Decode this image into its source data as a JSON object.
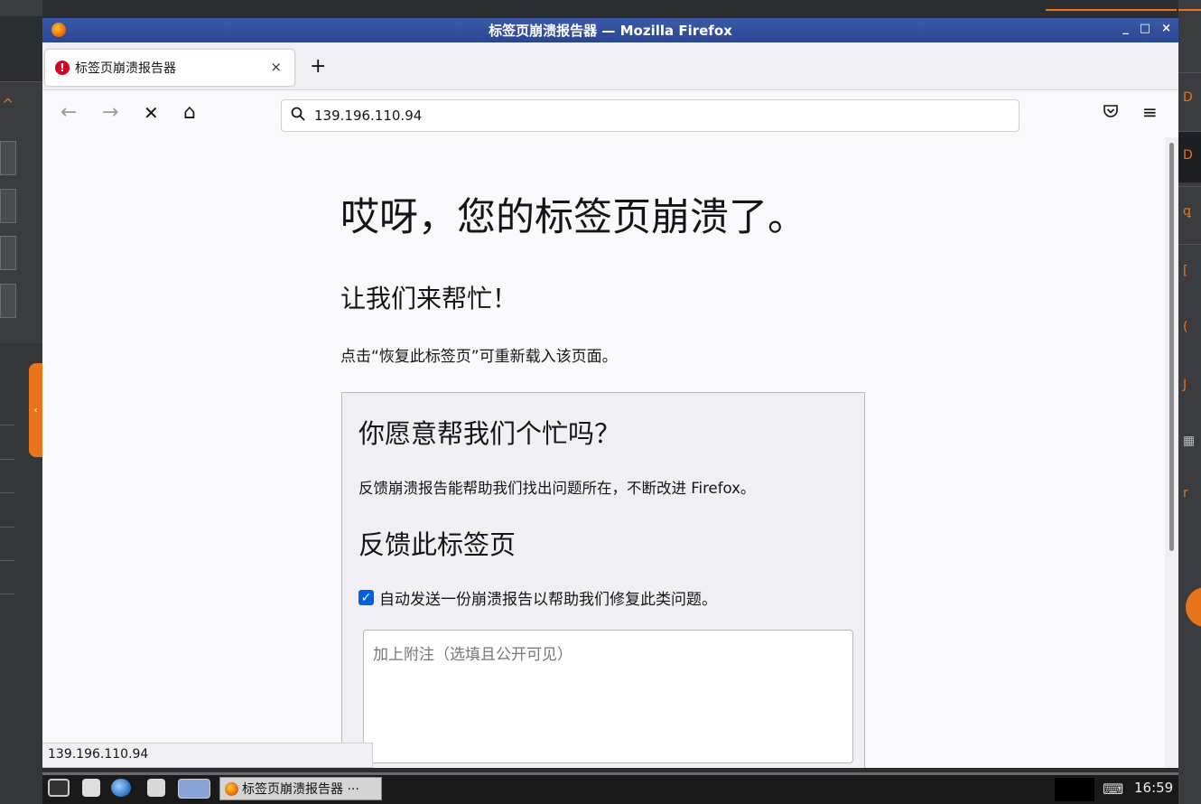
{
  "window": {
    "title": "标签页崩溃报告器 — Mozilla Firefox",
    "controls": {
      "minimize": "_",
      "maximize": "□",
      "close": "×"
    }
  },
  "tab": {
    "label": "标签页崩溃报告器",
    "close": "×",
    "icon": "warning-icon"
  },
  "new_tab": "+",
  "nav": {
    "back": "←",
    "forward": "→",
    "stop": "✕",
    "home": "⌂"
  },
  "url": {
    "value": "139.196.110.94"
  },
  "toolbar": {
    "pocket": "pocket-icon",
    "menu": "≡"
  },
  "content": {
    "title": "哎呀，您的标签页崩溃了。",
    "subtitle": "让我们来帮忙！",
    "instruction": "点击“恢复此标签页”可重新载入该页面。",
    "panel": {
      "heading": "你愿意帮我们个忙吗？",
      "description": "反馈崩溃报告能帮助我们找出问题所在，不断改进 Firefox。",
      "report_heading": "反馈此标签页",
      "checkbox_label": "自动发送一份崩溃报告以帮助我们修复此类问题。",
      "checkbox_checked": true,
      "comment_placeholder": "加上附注（选填且公开可见）"
    }
  },
  "status_url": "139.196.110.94",
  "taskbar": {
    "task_label": "标签页崩溃报告器 ···",
    "clock": "16:59"
  },
  "colors": {
    "title_bar": "#2a4693",
    "accent_orange": "#e8741c",
    "checkbox_blue": "#0061e0"
  }
}
